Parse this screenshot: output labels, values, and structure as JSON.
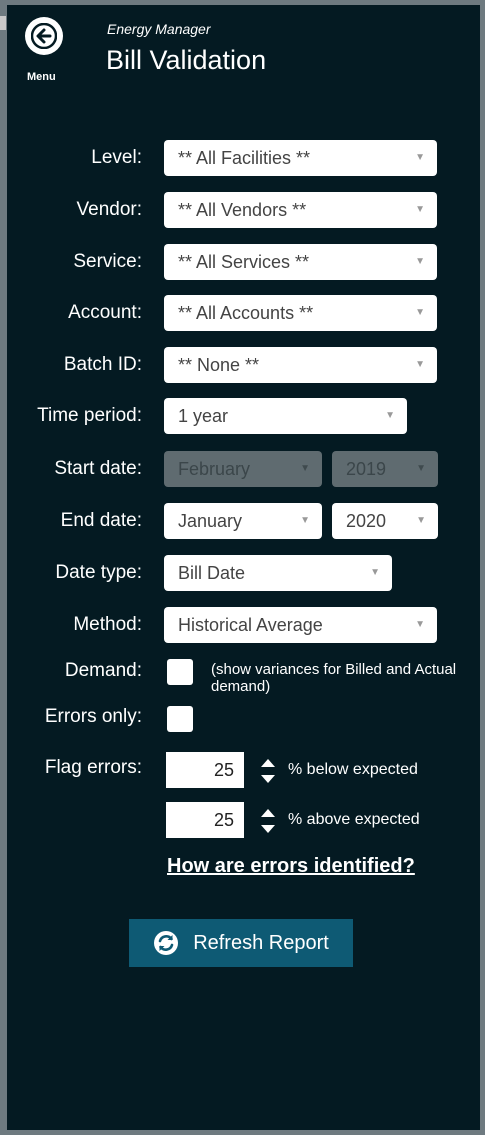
{
  "header": {
    "menu_label": "Menu",
    "app_name": "Energy Manager",
    "title": "Bill Validation"
  },
  "form": {
    "level": {
      "label": "Level:",
      "value": "** All Facilities **"
    },
    "vendor": {
      "label": "Vendor:",
      "value": "** All Vendors **"
    },
    "service": {
      "label": "Service:",
      "value": "** All Services **"
    },
    "account": {
      "label": "Account:",
      "value": "** All Accounts **"
    },
    "batch": {
      "label": "Batch ID:",
      "value": "** None **"
    },
    "time_period": {
      "label": "Time period:",
      "value": "1 year"
    },
    "start_date": {
      "label": "Start date:",
      "month": "February",
      "year": "2019"
    },
    "end_date": {
      "label": "End date:",
      "month": "January",
      "year": "2020"
    },
    "date_type": {
      "label": "Date type:",
      "value": "Bill Date"
    },
    "method": {
      "label": "Method:",
      "value": "Historical Average"
    },
    "demand": {
      "label": "Demand:",
      "note": "(show variances for Billed and Actual demand)"
    },
    "errors_only": {
      "label": "Errors only:"
    },
    "flag_errors": {
      "label": "Flag errors:",
      "below_value": "25",
      "below_label": "% below expected",
      "above_value": "25",
      "above_label": "% above expected"
    }
  },
  "help_link": "How are errors identified?",
  "refresh_button": "Refresh Report",
  "icons": [
    "back-arrow-icon",
    "dropdown-arrow-icon",
    "stepper-icon",
    "refresh-icon"
  ],
  "colors": {
    "panel_bg": "#041a22",
    "button_bg": "#0e5a74"
  }
}
